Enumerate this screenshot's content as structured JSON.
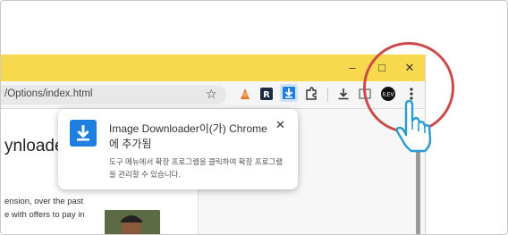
{
  "browser": {
    "url": "/Options/index.html",
    "window_controls": {
      "minimize": "–",
      "maximize": "□",
      "close": "✕"
    },
    "bookmark_icon": "star-icon",
    "more_icon": "vertical-ellipsis-icon"
  },
  "page": {
    "heading": "ynloade",
    "paragraph_lines": [
      "ension, over the past",
      "e with offers to pay in"
    ]
  },
  "popup": {
    "title": "Image Downloader이(가) Chrome 에 추가됨",
    "description": "도구 메뉴에서 확장 프로그램을 클릭하여 확장 프로그램을 관리할 수 있습니다.",
    "close_label": "✕",
    "icon": "download-icon"
  },
  "toolbar_icons": [
    "fox-extension-icon",
    "r-extension-icon",
    "image-downloader-icon",
    "puzzle-extensions-icon",
    "downloads-icon",
    "profile-avatar-icon",
    "more-menu-icon"
  ],
  "colors": {
    "titlebar": "#f8d84c",
    "highlight_circle": "#cc4a4a",
    "accent": "#1f7fe0"
  }
}
